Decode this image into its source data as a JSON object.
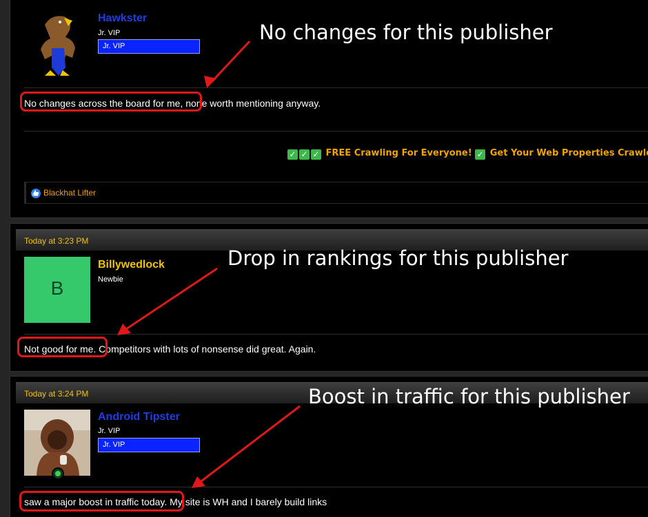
{
  "posts": [
    {
      "username": "Hawkster",
      "user_title": "Jr. VIP",
      "badge": "Jr. VIP",
      "message_highlight": "No changes across the board for me,",
      "message_rest": " none worth mentioning anyway.",
      "signature": "FREE Crawling For Everyone!",
      "signature_more": "Get Your Web Properties Crawled & I",
      "reaction": "Blackhat Lifter",
      "annotation": "No changes for this publisher"
    },
    {
      "date": "Today at 3:23 PM",
      "username": "Billywedlock",
      "user_title": "Newbie",
      "avatar_letter": "B",
      "message_highlight": "Not good for me.",
      "message_rest": " Competitors with lots of nonsense did great. Again.",
      "annotation": "Drop in rankings for this publisher"
    },
    {
      "date": "Today at 3:24 PM",
      "username": "Android Tipster",
      "user_title": "Jr. VIP",
      "badge": "Jr. VIP",
      "message_highlight": "saw a major boost in traffic today.",
      "message_rest": " My site is WH and I barely build links",
      "annotation": "Boost in traffic for this publisher"
    }
  ],
  "colors": {
    "background": "#000000",
    "date_text": "#f2c300",
    "vip_name": "#1f3de0",
    "newbie_name": "#f2c300",
    "badge_bg": "#0a24ff",
    "highlight": "#e01818",
    "signature_text": "#f2a300",
    "avatar_green": "#35c96b"
  },
  "icons": [
    "check-mark-icon",
    "like-icon",
    "online-status-icon"
  ]
}
